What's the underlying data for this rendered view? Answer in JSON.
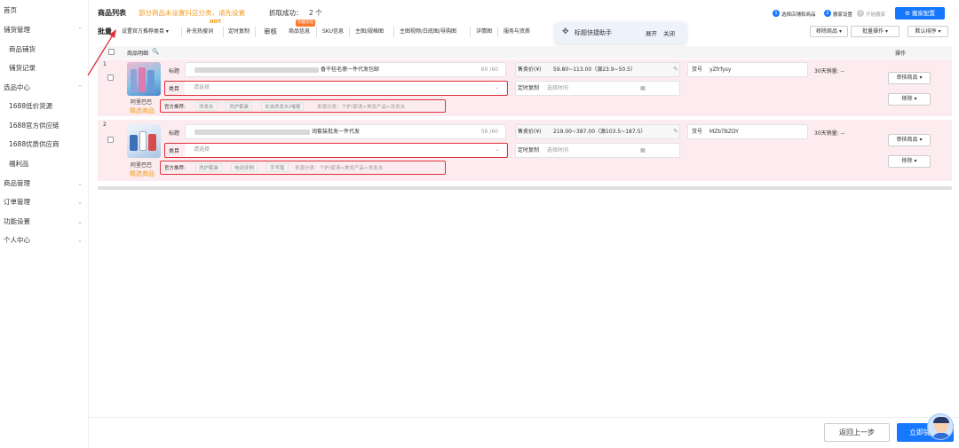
{
  "sidebar": {
    "items": [
      {
        "label": "首页",
        "chev": ""
      },
      {
        "label": "铺货管理",
        "chev": "⌃"
      },
      {
        "label": "商品铺货",
        "chev": "",
        "sub": true
      },
      {
        "label": "铺货记录",
        "chev": "",
        "sub": true
      },
      {
        "label": "选品中心",
        "chev": "⌃"
      },
      {
        "label": "1688低价货源",
        "chev": "",
        "sub": true
      },
      {
        "label": "1688官方供应链",
        "chev": "",
        "sub": true
      },
      {
        "label": "1688优质供应商",
        "chev": "",
        "sub": true
      },
      {
        "label": "福利品",
        "chev": "",
        "sub": true
      },
      {
        "label": "商品管理",
        "chev": "⌄"
      },
      {
        "label": "订单管理",
        "chev": "⌄"
      },
      {
        "label": "功能设置",
        "chev": "⌄"
      },
      {
        "label": "个人中心",
        "chev": "⌄"
      }
    ]
  },
  "header": {
    "title": "商品列表",
    "warning": "部分商品未设置抖店分类，请先设置",
    "count_label": "抓取成功：",
    "count_value": "2 个",
    "steps": [
      {
        "num": "1",
        "label": "选择店铺和商品"
      },
      {
        "num": "2",
        "label": "搬家设置"
      },
      {
        "num": "3",
        "label": "开始搬家"
      }
    ],
    "config_button": "搬家配置",
    "config_icon": "⚙"
  },
  "toolbar": {
    "batch_label": "批量",
    "items": [
      "设置官方推荐类目 ▾",
      "补充热搜词",
      "定时复制"
    ],
    "hot_badge": "HOT",
    "review_label": "审核",
    "review_items": [
      "商品信息",
      "SKU信息",
      "主图/规格图",
      "主图视频/白底图/导购图",
      "详情图",
      "服务与资质"
    ],
    "new_badge": "功能优化",
    "assistant_title": "标题快捷助手",
    "assistant_expand": "展开",
    "assistant_close": "关闭",
    "remove_button": "移除商品 ▾",
    "batch_op_button": "批量操作 ▾",
    "sort_button": "默认排序 ▾"
  },
  "table": {
    "header_detail": "商品明细",
    "header_op": "操作"
  },
  "rows": [
    {
      "index": "1",
      "title_label": "标题",
      "title_text": "香干桂毛擦一件代发包邮",
      "title_count": "60 /60",
      "category_label": "类目",
      "category_placeholder": "请选择",
      "price_label": "售卖价(¥)",
      "price_value": "59.80~113.00（源23.9~50.5）",
      "sku_label": "货号",
      "sku_value": "yZfrfysy",
      "sales": "30天销量: --",
      "timing_label": "定时复制",
      "timing_placeholder": "选择时间",
      "source": "阿里巴巴",
      "selected": "精选商品",
      "rec_label": "官方推荐:",
      "rec_tags": [
        "洗发水",
        "洗护套装",
        "去油洗发水/啫喱"
      ],
      "rec_source": "来源分类：个护/家清>美发产品>洗发水",
      "review_button": "审核商品 ▾",
      "remove_button": "移除 ▾"
    },
    {
      "index": "2",
      "title_label": "标题",
      "title_text": "润套装批发一件代发",
      "title_count": "56 /60",
      "category_label": "类目",
      "category_placeholder": "请选择",
      "price_label": "售卖价(¥)",
      "price_value": "219.00~387.00（源103.5~187.5）",
      "sku_label": "货号",
      "sku_value": "MZbTBZDY",
      "sales": "30天销量: --",
      "timing_label": "定时复制",
      "timing_placeholder": "选择时间",
      "source": "阿里巴巴",
      "selected": "精选商品",
      "rec_label": "官方推荐:",
      "rec_tags": [
        "洗护套装",
        "电动牙刷",
        "手写笔"
      ],
      "rec_source": "来源分类：个护/家清>美发产品>洗发水",
      "review_button": "审核商品 ▾",
      "remove_button": "移除 ▾"
    }
  ],
  "footer": {
    "back_button": "返回上一步",
    "go_button": "立即铺"
  },
  "colors": {
    "accent": "#1677ff",
    "warning": "#f39a1e",
    "danger": "#e0303a",
    "row_bg": "#fdecef"
  }
}
